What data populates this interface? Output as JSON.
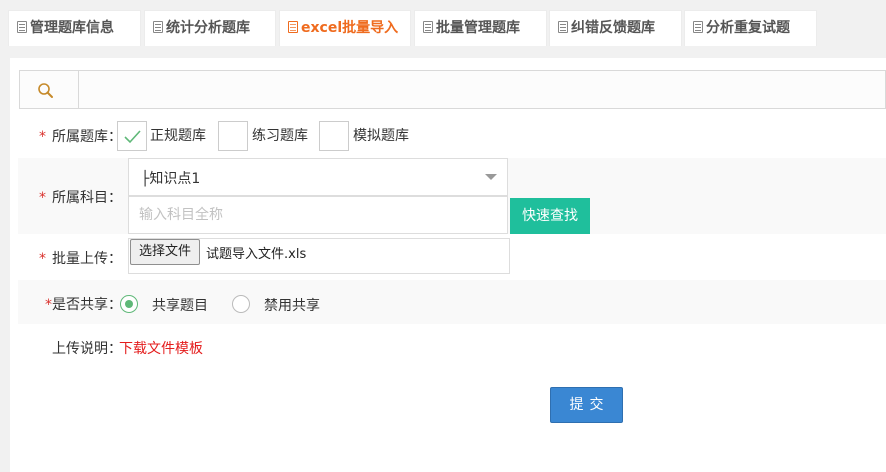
{
  "tabs": [
    {
      "label": "管理题库信息"
    },
    {
      "label": "统计分析题库"
    },
    {
      "label": "excel批量导入"
    },
    {
      "label": "批量管理题库"
    },
    {
      "label": "纠错反馈题库"
    },
    {
      "label": "分析重复试题"
    }
  ],
  "colors": {
    "active_tab": "#ef6b1e",
    "find_button": "#1fbf9c",
    "submit_button": "#3a87d3",
    "required": "#d9302c",
    "link": "#e41d1d"
  },
  "form": {
    "bank": {
      "required_mark": "*",
      "label": "所属题库：",
      "options": [
        {
          "label": "正规题库",
          "checked": true
        },
        {
          "label": "练习题库",
          "checked": false
        },
        {
          "label": "模拟题库",
          "checked": false
        }
      ]
    },
    "subject": {
      "required_mark": "*",
      "label": "所属科目：",
      "selected": "├知识点1",
      "search_placeholder": "输入科目全称",
      "find_button": "快速查找"
    },
    "upload": {
      "required_mark": "*",
      "label": "批量上传：",
      "choose_button": "选择文件",
      "file_name": "试题导入文件.xls"
    },
    "share": {
      "required_mark": "*",
      "label": "是否共享：",
      "options": [
        {
          "label": "共享题目",
          "selected": true
        },
        {
          "label": "禁用共享",
          "selected": false
        }
      ]
    },
    "note": {
      "label": "上传说明：",
      "link": "下载文件模板"
    },
    "submit_label": "提交"
  }
}
